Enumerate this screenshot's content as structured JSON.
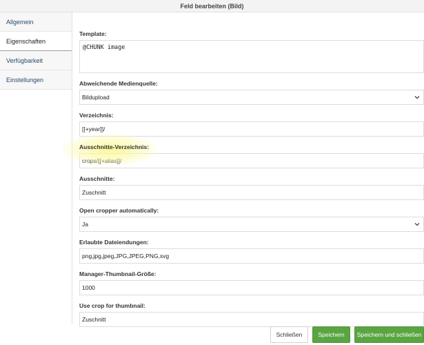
{
  "dialog": {
    "title": "Feld bearbeiten (Bild)"
  },
  "sidebar": {
    "items": [
      {
        "label": "Allgemein"
      },
      {
        "label": "Eigenschaften"
      },
      {
        "label": "Verfügbarkeit"
      },
      {
        "label": "Einstellungen"
      }
    ],
    "active_index": 1
  },
  "form": {
    "template": {
      "label": "Template:",
      "value": "@CHUNK image"
    },
    "media_source": {
      "label": "Abweichende Medienquelle:",
      "value": "Bildupload"
    },
    "directory": {
      "label": "Verzeichnis:",
      "value": "[[+year]]/"
    },
    "crops_directory": {
      "label": "Ausschnitte-Verzeichnis:",
      "value": "crops/[[+alias]]/"
    },
    "crops": {
      "label": "Ausschnitte:",
      "value": "Zuschnitt"
    },
    "open_cropper": {
      "label": "Open cropper automatically:",
      "value": "Ja"
    },
    "allowed_extensions": {
      "label": "Erlaubte Dateiendungen:",
      "value": "png,jpg,jpeg,JPG,JPEG,PNG,svg"
    },
    "thumbnail_size": {
      "label": "Manager-Thumbnail-Größe:",
      "value": "1000"
    },
    "crop_thumbnail": {
      "label": "Use crop for thumbnail:",
      "value": "Zuschnitt"
    }
  },
  "footer": {
    "close_label": "Schließen",
    "save_label": "Speichern",
    "save_close_label": "Speichern und schließen"
  },
  "colors": {
    "primary_button": "#5aa542",
    "highlight": "#faf88c",
    "sidebar_link": "#2a4a6b"
  },
  "icons": {
    "select_arrow": "chevron-down-icon"
  }
}
